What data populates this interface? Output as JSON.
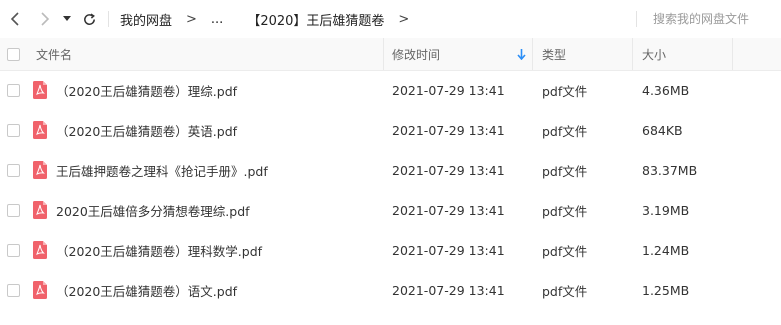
{
  "toolbar": {
    "breadcrumb": [
      "我的网盘",
      "...",
      "【2020】王后雄猜题卷"
    ],
    "separator": ">",
    "search_placeholder": "搜索我的网盘文件"
  },
  "columns": {
    "name": "文件名",
    "modified": "修改时间",
    "type": "类型",
    "size": "大小"
  },
  "files": [
    {
      "name": "（2020王后雄猜题卷）理综.pdf",
      "modified": "2021-07-29 13:41",
      "type": "pdf文件",
      "size": "4.36MB"
    },
    {
      "name": "（2020王后雄猜题卷）英语.pdf",
      "modified": "2021-07-29 13:41",
      "type": "pdf文件",
      "size": "684KB"
    },
    {
      "name": "王后雄押题卷之理科《抢记手册》.pdf",
      "modified": "2021-07-29 13:41",
      "type": "pdf文件",
      "size": "83.37MB"
    },
    {
      "name": "2020王后雄倍多分猜想卷理综.pdf",
      "modified": "2021-07-29 13:41",
      "type": "pdf文件",
      "size": "3.19MB"
    },
    {
      "name": "（2020王后雄猜题卷）理科数学.pdf",
      "modified": "2021-07-29 13:41",
      "type": "pdf文件",
      "size": "1.24MB"
    },
    {
      "name": "（2020王后雄猜题卷）语文.pdf",
      "modified": "2021-07-29 13:41",
      "type": "pdf文件",
      "size": "1.25MB"
    }
  ],
  "colors": {
    "pdf_icon": "#f0626b",
    "sort_arrow": "#2b8ef7"
  }
}
